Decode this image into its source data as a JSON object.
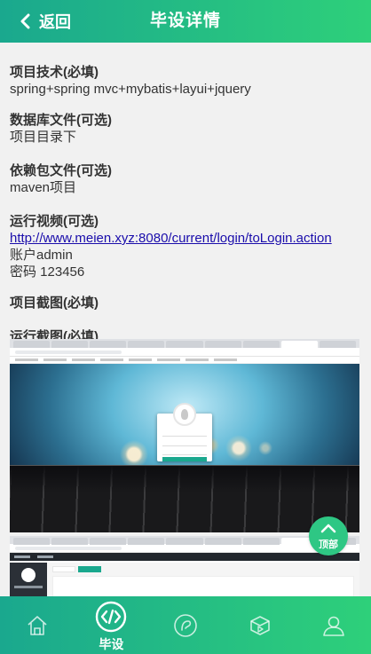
{
  "header": {
    "back_label": "返回",
    "title": "毕设详情"
  },
  "sections": {
    "tech": {
      "title": "项目技术(必填)",
      "value": "spring+spring mvc+mybatis+layui+jquery"
    },
    "db": {
      "title": "数据库文件(可选)",
      "value": "项目目录下"
    },
    "deps": {
      "title": "依赖包文件(可选)",
      "value": "maven项目"
    },
    "video": {
      "title": "运行视频(可选)",
      "link": "http://www.meien.xyz:8080/current/login/toLogin.action",
      "account": "账户admin",
      "password": "密码 123456"
    },
    "project_shots": {
      "title": "项目截图(必填)"
    },
    "run_shots": {
      "title": "运行截图(必填)"
    }
  },
  "top_button": {
    "label": "顶部",
    "icon": "chevron-up-icon"
  },
  "tabbar": {
    "items": [
      {
        "icon": "home-icon",
        "label": ""
      },
      {
        "icon": "code-icon",
        "label": "毕设",
        "active": true
      },
      {
        "icon": "compass-icon",
        "label": ""
      },
      {
        "icon": "video-icon",
        "label": ""
      },
      {
        "icon": "user-icon",
        "label": ""
      }
    ]
  },
  "colors": {
    "brand_start": "#1aa88e",
    "brand_end": "#2ed07a",
    "link": "#1a0dab",
    "background": "#f1f1f1"
  }
}
